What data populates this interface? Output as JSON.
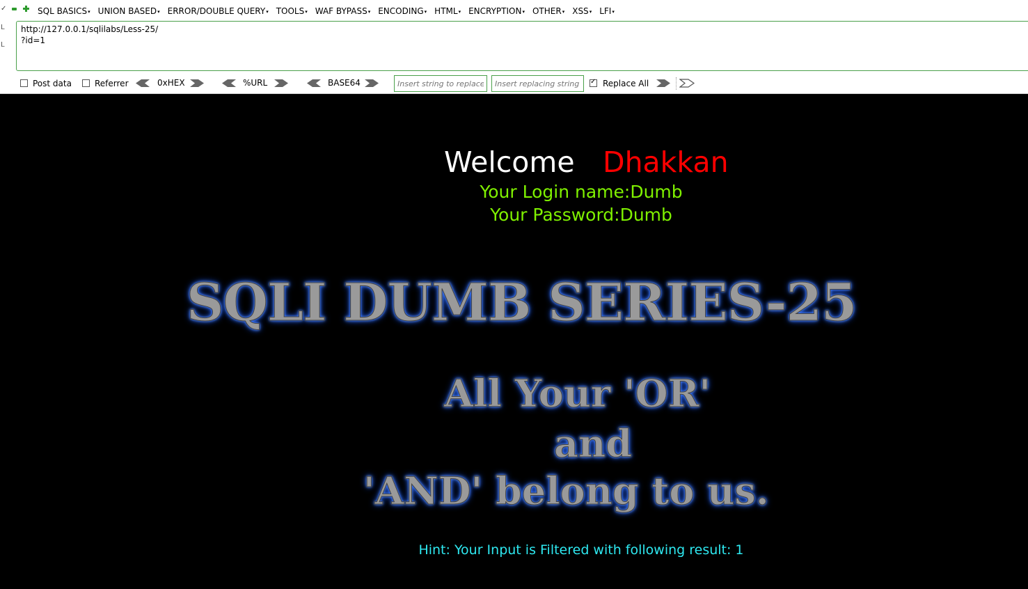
{
  "menubar": {
    "items": [
      "SQL BASICS",
      "UNION BASED",
      "ERROR/DOUBLE QUERY",
      "TOOLS",
      "WAF BYPASS",
      "ENCODING",
      "HTML",
      "ENCRYPTION",
      "OTHER",
      "XSS",
      "LFI"
    ]
  },
  "url": {
    "line1": "http://127.0.0.1/sqlilabs/Less-25/",
    "line2": "?id=1",
    "side_labels": [
      "L",
      "L"
    ]
  },
  "options": {
    "post_data": "Post data",
    "referrer": "Referrer",
    "hex": "0xHEX",
    "url_enc": "%URL",
    "base64": "BASE64",
    "insert_find_placeholder": "Insert string to replace",
    "insert_replace_placeholder": "Insert replacing string",
    "replace_all": "Replace All",
    "post_data_checked": false,
    "referrer_checked": false,
    "replace_all_checked": true
  },
  "page": {
    "welcome": "Welcome",
    "user": "Dhakkan",
    "login_name": "Your Login name:Dumb",
    "password": "Your Password:Dumb",
    "banner_title": "SQLI DUMB SERIES-25",
    "banner_line1": "All Your 'OR'",
    "banner_line2": "and",
    "banner_line3": "'AND' belong to us.",
    "hint": "Hint: Your Input is Filtered with following result: 1"
  },
  "colors": {
    "welcome": "#ffffff",
    "user": "#ff0000",
    "info": "#7ff000",
    "hint": "#2ee8f0",
    "border_green": "#4aa04a"
  }
}
